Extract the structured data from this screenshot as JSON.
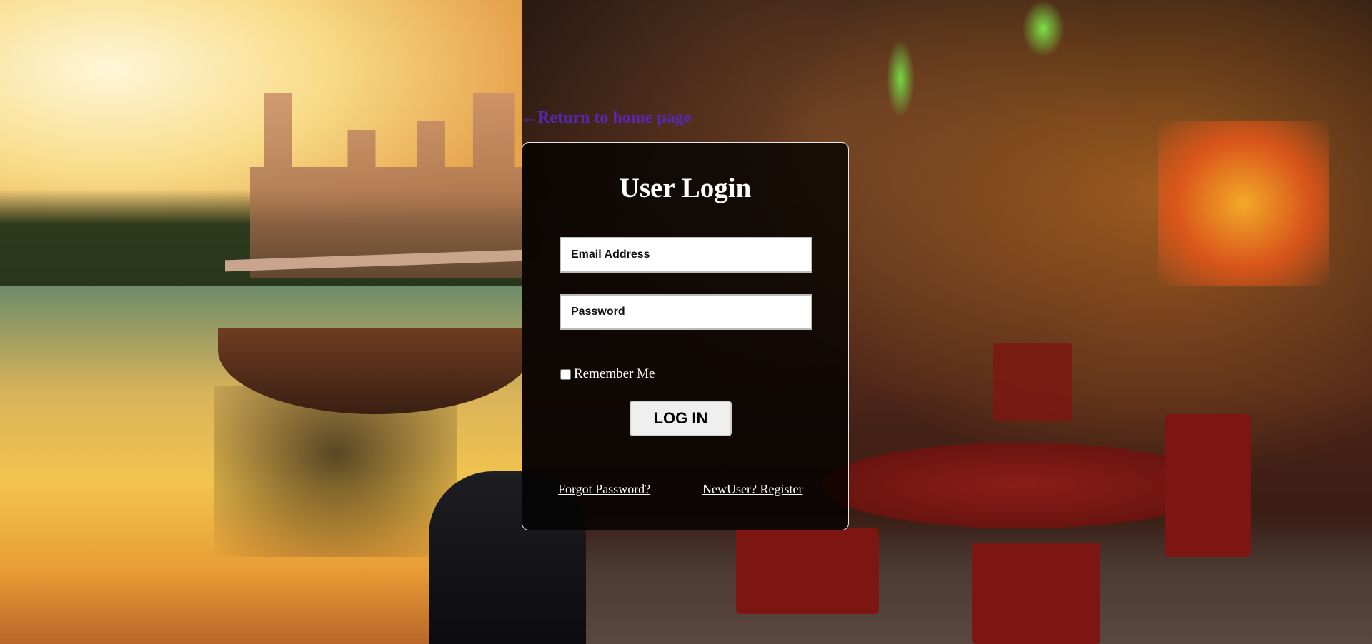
{
  "nav": {
    "return_link": "←Return to home page"
  },
  "login": {
    "title": "User Login",
    "email_placeholder": "Email Address",
    "password_placeholder": "Password",
    "remember_label": "Remember Me",
    "remember_checked": false,
    "submit_label": "LOG IN",
    "forgot_link": "Forgot Password?",
    "register_link": "NewUser? Register"
  },
  "colors": {
    "return_link": "#5a26b4",
    "card_background": "rgba(0,0,0,0.78)",
    "card_border": "#e8e8e8",
    "title_text": "#ffffff"
  }
}
